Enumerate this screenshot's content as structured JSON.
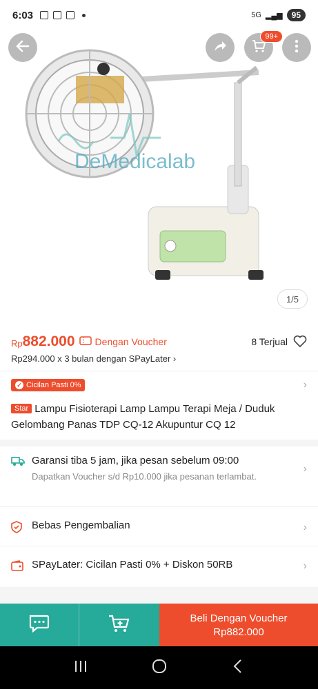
{
  "status_bar": {
    "time": "6:03",
    "network": "5G",
    "battery": "95"
  },
  "product": {
    "image_counter": "1/5",
    "watermark": "DeMedicalab",
    "cart_badge": "99+"
  },
  "price": {
    "currency": "Rp",
    "value": "882.000",
    "voucher_label": "Dengan Voucher",
    "sold": "8 Terjual",
    "paylater": "Rp294.000 x 3 bulan dengan SPayLater ›"
  },
  "cicilan_badge": "Cicilan Pasti 0%",
  "title": {
    "badge": "Star",
    "text": "Lampu Fisioterapi Lamp Lampu Terapi Meja / Duduk Gelombang Panas TDP CQ-12 Akupuntur CQ 12"
  },
  "shipping": {
    "main": "Garansi tiba 5 jam, jika pesan sebelum 09:00",
    "sub": "Dapatkan Voucher s/d Rp10.000 jika pesanan terlambat."
  },
  "returns": {
    "main": "Bebas Pengembalian"
  },
  "spaylater": {
    "main": "SPayLater: Cicilan Pasti 0% + Diskon 50RB"
  },
  "bottom_bar": {
    "buy_label": "Beli Dengan Voucher",
    "buy_price": "Rp882.000"
  },
  "colors": {
    "accent": "#ee4d2d",
    "teal": "#26aa99"
  },
  "icons": [
    "back-icon",
    "share-icon",
    "cart-icon",
    "more-icon",
    "heart-icon",
    "truck-icon",
    "shield-icon",
    "wallet-icon",
    "chat-icon",
    "add-cart-icon"
  ]
}
